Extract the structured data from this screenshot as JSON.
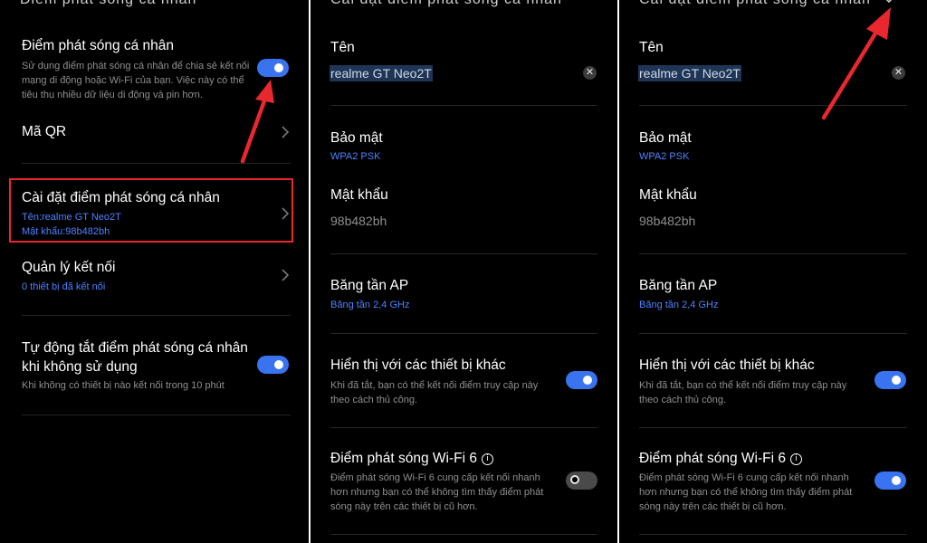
{
  "left": {
    "top_cut": "Điểm phát sóng cá nhân",
    "hotspot_title": "Điểm phát sóng cá nhân",
    "hotspot_desc": "Sử dụng điểm phát sóng cá nhân để chia sẻ kết nối mạng di động hoặc Wi-Fi của bạn. Việc này có thể tiêu thụ nhiều dữ liệu di động và pin hơn.",
    "qr_title": "Mã QR",
    "settings_title": "Cài đặt điểm phát sóng cá nhân",
    "settings_name": "Tên:realme GT Neo2T",
    "settings_password": "Mật khẩu:98b482bh",
    "manage_title": "Quản lý kết nối",
    "manage_sub": "0 thiết bị đã kết nối",
    "auto_off_title": "Tự động tắt điểm phát sóng cá nhân khi không sử dụng",
    "auto_off_desc": "Khi không có thiết bị nào kết nối trong 10 phút",
    "hotspot_toggle": "on",
    "auto_off_toggle": "on"
  },
  "mid": {
    "top_cut": "Cài đặt điểm phát sóng cá nhân",
    "name_label": "Tên",
    "name_value": "realme GT Neo2T",
    "security_label": "Bảo mật",
    "security_value": "WPA2 PSK",
    "password_label": "Mật khẩu",
    "password_value": "98b482bh",
    "band_label": "Băng tần AP",
    "band_value": "Băng tần 2,4 GHz",
    "visible_label": "Hiển thị với các thiết bị khác",
    "visible_desc": "Khi đã tắt, bạn có thể kết nối điểm truy cập này theo cách thủ công.",
    "wifi6_label": "Điểm phát sóng Wi-Fi 6",
    "wifi6_desc": "Điểm phát sóng Wi-Fi 6 cung cấp kết nối nhanh hơn nhưng bạn có thể không tìm thấy điểm phát sóng này trên các thiết bị cũ hơn.",
    "visible_toggle": "on",
    "wifi6_toggle": "off"
  },
  "right": {
    "top_cut": "Cài đặt điểm phát sóng cá nhân",
    "name_label": "Tên",
    "name_value": "realme GT Neo2T",
    "security_label": "Bảo mật",
    "security_value": "WPA2 PSK",
    "password_label": "Mật khẩu",
    "password_value": "98b482bh",
    "band_label": "Băng tần AP",
    "band_value": "Băng tần 2,4 GHz",
    "visible_label": "Hiển thị với các thiết bị khác",
    "visible_desc": "Khi đã tắt, bạn có thể kết nối điểm truy cập này theo cách thủ công.",
    "wifi6_label": "Điểm phát sóng Wi-Fi 6",
    "wifi6_desc": "Điểm phát sóng Wi-Fi 6 cung cấp kết nối nhanh hơn nhưng bạn có thể không tìm thấy điểm phát sóng này trên các thiết bị cũ hơn.",
    "visible_toggle": "on",
    "wifi6_toggle": "on"
  },
  "icons": {
    "chevron": "chevron-right-icon",
    "clear": "clear-text-icon",
    "info": "info-icon",
    "check": "checkmark-icon",
    "arrow": "red-pointer-arrow"
  },
  "colors": {
    "background": "#000000",
    "accent": "#3a73f0",
    "link": "#4d82ff",
    "annotation": "#e8272e"
  }
}
